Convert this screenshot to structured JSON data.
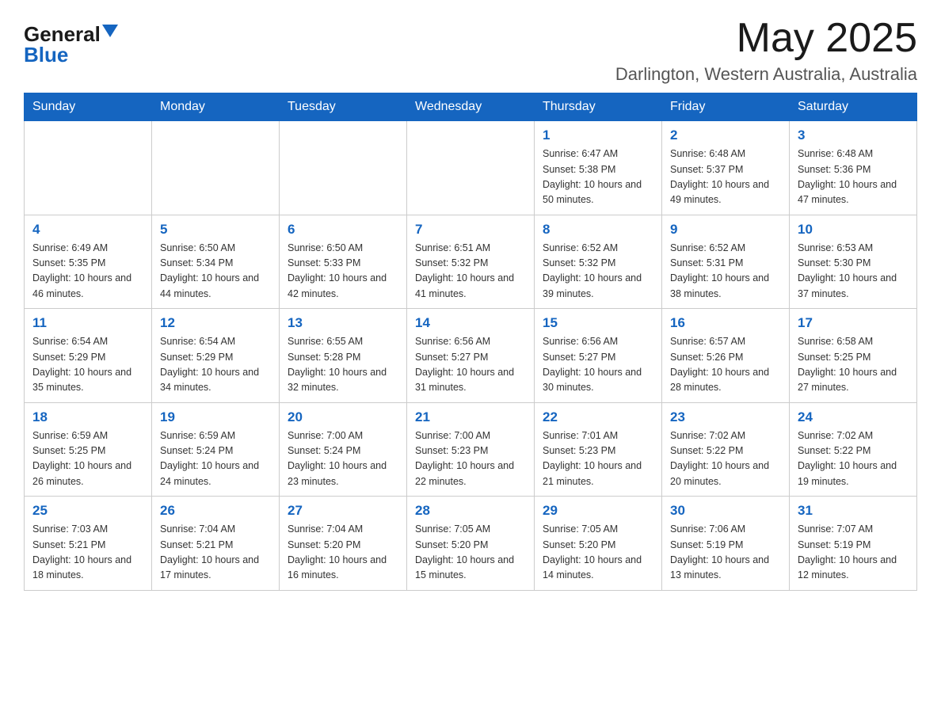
{
  "logo": {
    "general": "General",
    "blue": "Blue"
  },
  "header": {
    "month": "May 2025",
    "location": "Darlington, Western Australia, Australia"
  },
  "weekdays": [
    "Sunday",
    "Monday",
    "Tuesday",
    "Wednesday",
    "Thursday",
    "Friday",
    "Saturday"
  ],
  "weeks": [
    [
      {
        "day": "",
        "info": ""
      },
      {
        "day": "",
        "info": ""
      },
      {
        "day": "",
        "info": ""
      },
      {
        "day": "",
        "info": ""
      },
      {
        "day": "1",
        "info": "Sunrise: 6:47 AM\nSunset: 5:38 PM\nDaylight: 10 hours\nand 50 minutes."
      },
      {
        "day": "2",
        "info": "Sunrise: 6:48 AM\nSunset: 5:37 PM\nDaylight: 10 hours\nand 49 minutes."
      },
      {
        "day": "3",
        "info": "Sunrise: 6:48 AM\nSunset: 5:36 PM\nDaylight: 10 hours\nand 47 minutes."
      }
    ],
    [
      {
        "day": "4",
        "info": "Sunrise: 6:49 AM\nSunset: 5:35 PM\nDaylight: 10 hours\nand 46 minutes."
      },
      {
        "day": "5",
        "info": "Sunrise: 6:50 AM\nSunset: 5:34 PM\nDaylight: 10 hours\nand 44 minutes."
      },
      {
        "day": "6",
        "info": "Sunrise: 6:50 AM\nSunset: 5:33 PM\nDaylight: 10 hours\nand 42 minutes."
      },
      {
        "day": "7",
        "info": "Sunrise: 6:51 AM\nSunset: 5:32 PM\nDaylight: 10 hours\nand 41 minutes."
      },
      {
        "day": "8",
        "info": "Sunrise: 6:52 AM\nSunset: 5:32 PM\nDaylight: 10 hours\nand 39 minutes."
      },
      {
        "day": "9",
        "info": "Sunrise: 6:52 AM\nSunset: 5:31 PM\nDaylight: 10 hours\nand 38 minutes."
      },
      {
        "day": "10",
        "info": "Sunrise: 6:53 AM\nSunset: 5:30 PM\nDaylight: 10 hours\nand 37 minutes."
      }
    ],
    [
      {
        "day": "11",
        "info": "Sunrise: 6:54 AM\nSunset: 5:29 PM\nDaylight: 10 hours\nand 35 minutes."
      },
      {
        "day": "12",
        "info": "Sunrise: 6:54 AM\nSunset: 5:29 PM\nDaylight: 10 hours\nand 34 minutes."
      },
      {
        "day": "13",
        "info": "Sunrise: 6:55 AM\nSunset: 5:28 PM\nDaylight: 10 hours\nand 32 minutes."
      },
      {
        "day": "14",
        "info": "Sunrise: 6:56 AM\nSunset: 5:27 PM\nDaylight: 10 hours\nand 31 minutes."
      },
      {
        "day": "15",
        "info": "Sunrise: 6:56 AM\nSunset: 5:27 PM\nDaylight: 10 hours\nand 30 minutes."
      },
      {
        "day": "16",
        "info": "Sunrise: 6:57 AM\nSunset: 5:26 PM\nDaylight: 10 hours\nand 28 minutes."
      },
      {
        "day": "17",
        "info": "Sunrise: 6:58 AM\nSunset: 5:25 PM\nDaylight: 10 hours\nand 27 minutes."
      }
    ],
    [
      {
        "day": "18",
        "info": "Sunrise: 6:59 AM\nSunset: 5:25 PM\nDaylight: 10 hours\nand 26 minutes."
      },
      {
        "day": "19",
        "info": "Sunrise: 6:59 AM\nSunset: 5:24 PM\nDaylight: 10 hours\nand 24 minutes."
      },
      {
        "day": "20",
        "info": "Sunrise: 7:00 AM\nSunset: 5:24 PM\nDaylight: 10 hours\nand 23 minutes."
      },
      {
        "day": "21",
        "info": "Sunrise: 7:00 AM\nSunset: 5:23 PM\nDaylight: 10 hours\nand 22 minutes."
      },
      {
        "day": "22",
        "info": "Sunrise: 7:01 AM\nSunset: 5:23 PM\nDaylight: 10 hours\nand 21 minutes."
      },
      {
        "day": "23",
        "info": "Sunrise: 7:02 AM\nSunset: 5:22 PM\nDaylight: 10 hours\nand 20 minutes."
      },
      {
        "day": "24",
        "info": "Sunrise: 7:02 AM\nSunset: 5:22 PM\nDaylight: 10 hours\nand 19 minutes."
      }
    ],
    [
      {
        "day": "25",
        "info": "Sunrise: 7:03 AM\nSunset: 5:21 PM\nDaylight: 10 hours\nand 18 minutes."
      },
      {
        "day": "26",
        "info": "Sunrise: 7:04 AM\nSunset: 5:21 PM\nDaylight: 10 hours\nand 17 minutes."
      },
      {
        "day": "27",
        "info": "Sunrise: 7:04 AM\nSunset: 5:20 PM\nDaylight: 10 hours\nand 16 minutes."
      },
      {
        "day": "28",
        "info": "Sunrise: 7:05 AM\nSunset: 5:20 PM\nDaylight: 10 hours\nand 15 minutes."
      },
      {
        "day": "29",
        "info": "Sunrise: 7:05 AM\nSunset: 5:20 PM\nDaylight: 10 hours\nand 14 minutes."
      },
      {
        "day": "30",
        "info": "Sunrise: 7:06 AM\nSunset: 5:19 PM\nDaylight: 10 hours\nand 13 minutes."
      },
      {
        "day": "31",
        "info": "Sunrise: 7:07 AM\nSunset: 5:19 PM\nDaylight: 10 hours\nand 12 minutes."
      }
    ]
  ]
}
